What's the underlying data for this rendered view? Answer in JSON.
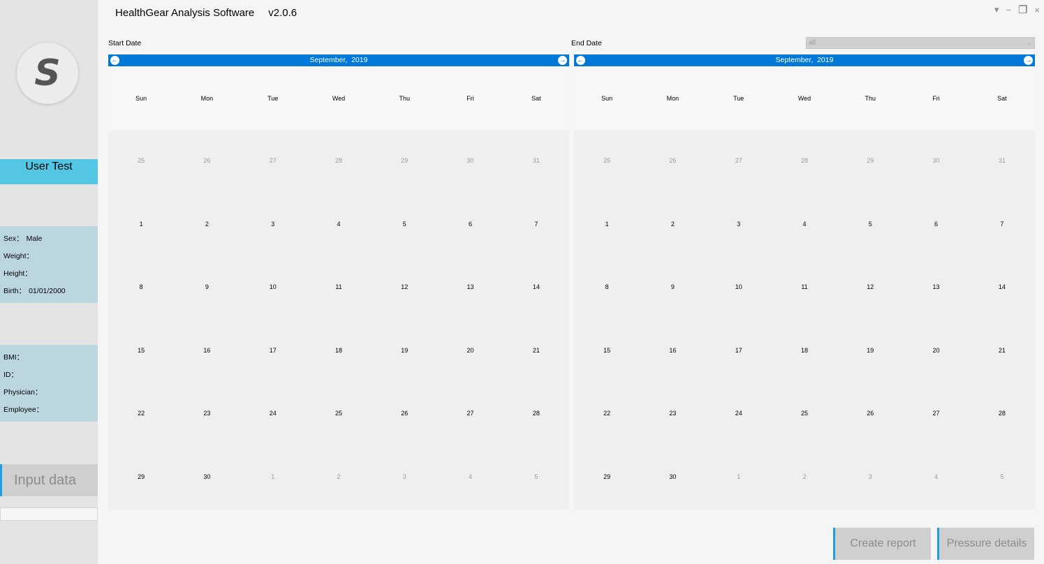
{
  "app": {
    "title": "HealthGear Analysis Software",
    "version": "v2.0.6"
  },
  "window_controls": {
    "menu": "▾",
    "minimize": "−",
    "restore": "❐",
    "close": "×"
  },
  "sidebar": {
    "logo_glyph": "S",
    "user_name": "User  Test",
    "personal": [
      {
        "label": "Sex：",
        "value": "Male"
      },
      {
        "label": "Weight：",
        "value": ""
      },
      {
        "label": "Height：",
        "value": ""
      },
      {
        "label": "Birth：",
        "value": "01/01/2000"
      }
    ],
    "clinical": [
      {
        "label": "BMI：",
        "value": ""
      },
      {
        "label": "ID：",
        "value": ""
      },
      {
        "label": "Physician：",
        "value": ""
      },
      {
        "label": "Employee：",
        "value": ""
      }
    ],
    "input_button": "Input data"
  },
  "start_date_label": "Start Date",
  "end_date_label": "End Date",
  "filter_select": {
    "value": "all",
    "arrow": "⌄"
  },
  "calendars": {
    "start": {
      "month": "September",
      "year": "2019"
    },
    "end": {
      "month": "September",
      "year": "2019"
    }
  },
  "weekdays": [
    "Sun",
    "Mon",
    "Tue",
    "Wed",
    "Thu",
    "Fri",
    "Sat"
  ],
  "days": [
    {
      "d": "25",
      "other": true
    },
    {
      "d": "26",
      "other": true
    },
    {
      "d": "27",
      "other": true
    },
    {
      "d": "28",
      "other": true
    },
    {
      "d": "29",
      "other": true
    },
    {
      "d": "30",
      "other": true
    },
    {
      "d": "31",
      "other": true
    },
    {
      "d": "1"
    },
    {
      "d": "2"
    },
    {
      "d": "3"
    },
    {
      "d": "4"
    },
    {
      "d": "5"
    },
    {
      "d": "6"
    },
    {
      "d": "7"
    },
    {
      "d": "8"
    },
    {
      "d": "9"
    },
    {
      "d": "10"
    },
    {
      "d": "11"
    },
    {
      "d": "12"
    },
    {
      "d": "13"
    },
    {
      "d": "14"
    },
    {
      "d": "15"
    },
    {
      "d": "16"
    },
    {
      "d": "17"
    },
    {
      "d": "18"
    },
    {
      "d": "19"
    },
    {
      "d": "20"
    },
    {
      "d": "21"
    },
    {
      "d": "22"
    },
    {
      "d": "23"
    },
    {
      "d": "24"
    },
    {
      "d": "25"
    },
    {
      "d": "26"
    },
    {
      "d": "27"
    },
    {
      "d": "28"
    },
    {
      "d": "29"
    },
    {
      "d": "30"
    },
    {
      "d": "1",
      "other": true
    },
    {
      "d": "2",
      "other": true
    },
    {
      "d": "3",
      "other": true
    },
    {
      "d": "4",
      "other": true
    },
    {
      "d": "5",
      "other": true
    }
  ],
  "buttons": {
    "create_report": "Create report",
    "pressure_details": "Pressure details"
  },
  "colors": {
    "header_blue": "#0078d7",
    "accent": "#1e9ee0",
    "user_bar": "#52c6e3",
    "info_bg": "#bcd6df"
  }
}
